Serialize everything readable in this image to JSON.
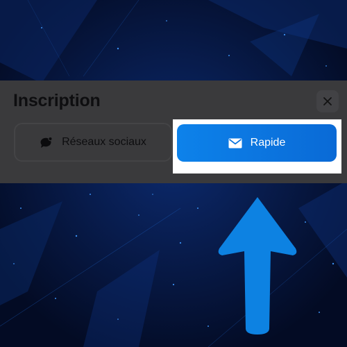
{
  "modal": {
    "title": "Inscription"
  },
  "tabs": {
    "social_label": "Réseaux sociaux",
    "quick_label": "Rapide"
  },
  "icons": {
    "close": "close-icon",
    "social": "chat-bubble-icon",
    "quick": "envelope-icon",
    "pointer": "up-arrow-icon"
  },
  "colors": {
    "accent": "#0a74e0",
    "arrow": "#0d82e2",
    "backdrop": "#06163c"
  }
}
